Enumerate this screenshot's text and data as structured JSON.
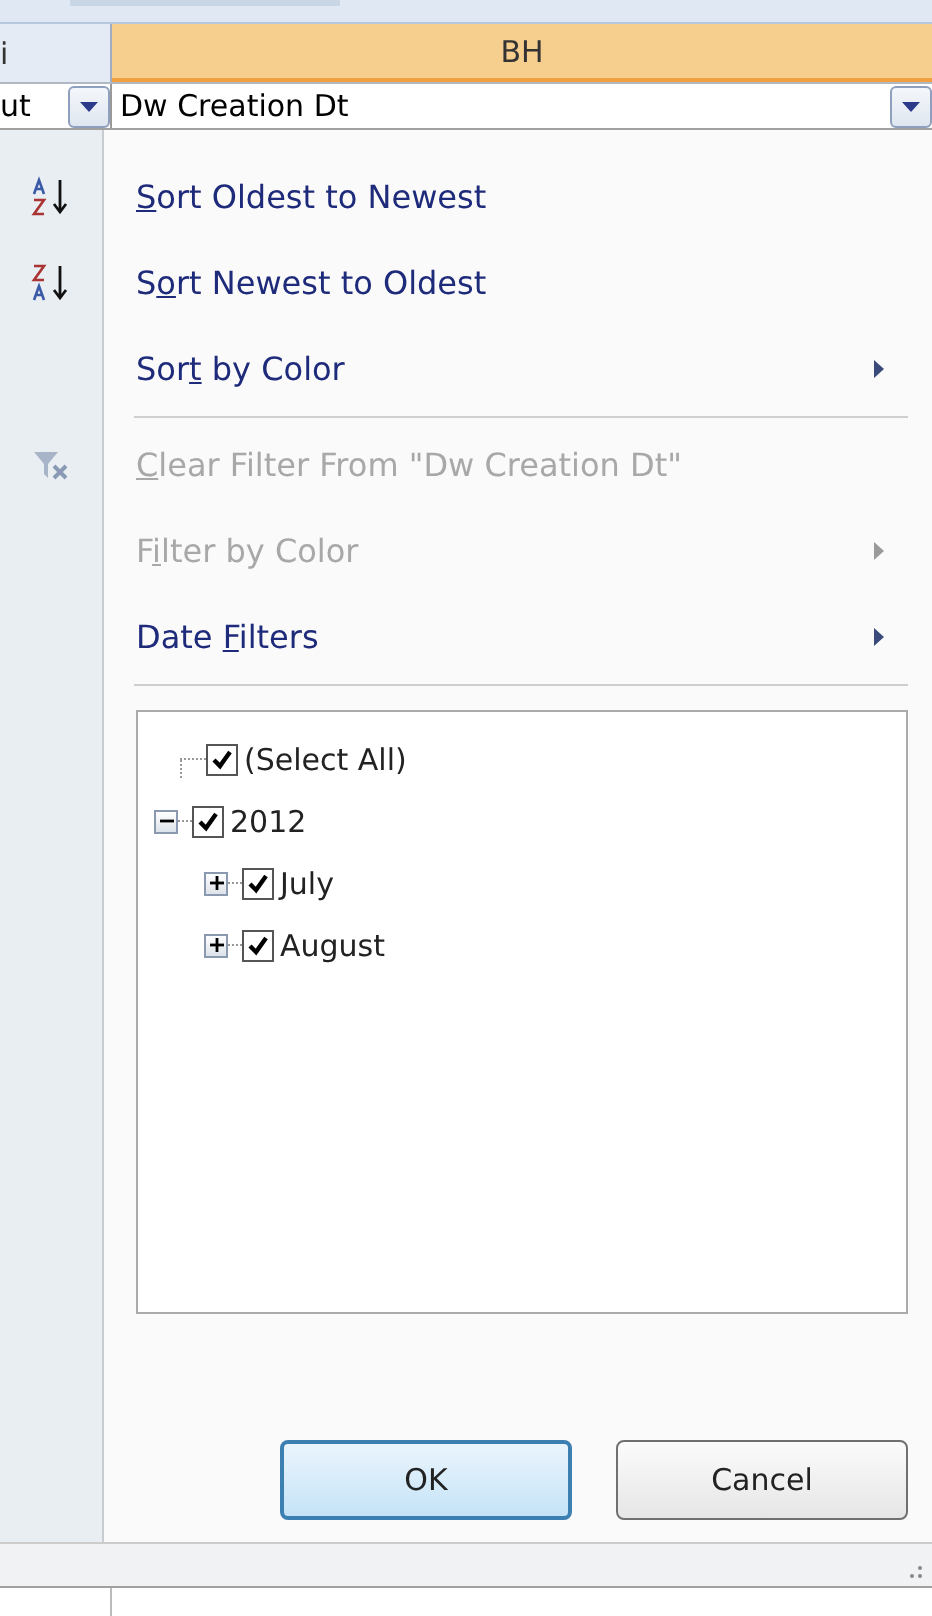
{
  "sheet": {
    "prev_column_header": "i",
    "column_header": "BH",
    "prev_cell": "ut",
    "header_cell": "Dw Creation Dt"
  },
  "menu": {
    "items": [
      {
        "kind": "item",
        "key": "S",
        "post": "ort Oldest to Newest",
        "disabled": false,
        "submenu": false
      },
      {
        "kind": "item",
        "pre": "S",
        "key": "o",
        "post": "rt Newest to Oldest",
        "disabled": false,
        "submenu": false
      },
      {
        "kind": "item",
        "pre": "Sor",
        "key": "t",
        "post": " by Color",
        "disabled": false,
        "submenu": true
      },
      {
        "kind": "separator"
      },
      {
        "kind": "item",
        "key": "C",
        "post": "lear Filter From \"Dw Creation Dt\"",
        "disabled": true,
        "submenu": false
      },
      {
        "kind": "item",
        "pre": "F",
        "key": "i",
        "post": "lter by Color",
        "disabled": true,
        "submenu": true
      },
      {
        "kind": "item",
        "pre": "Date ",
        "key": "F",
        "post": "ilters",
        "disabled": false,
        "submenu": true
      },
      {
        "kind": "separator"
      }
    ],
    "tree": [
      {
        "label": "(Select All)",
        "checked": true
      },
      {
        "label": "2012",
        "checked": true,
        "expanded": true,
        "children": [
          {
            "label": "July",
            "checked": true,
            "expanded": false
          },
          {
            "label": "August",
            "checked": true,
            "expanded": false
          }
        ]
      }
    ],
    "buttons": [
      {
        "label": "OK",
        "default": true
      },
      {
        "label": "Cancel",
        "default": false
      }
    ]
  }
}
